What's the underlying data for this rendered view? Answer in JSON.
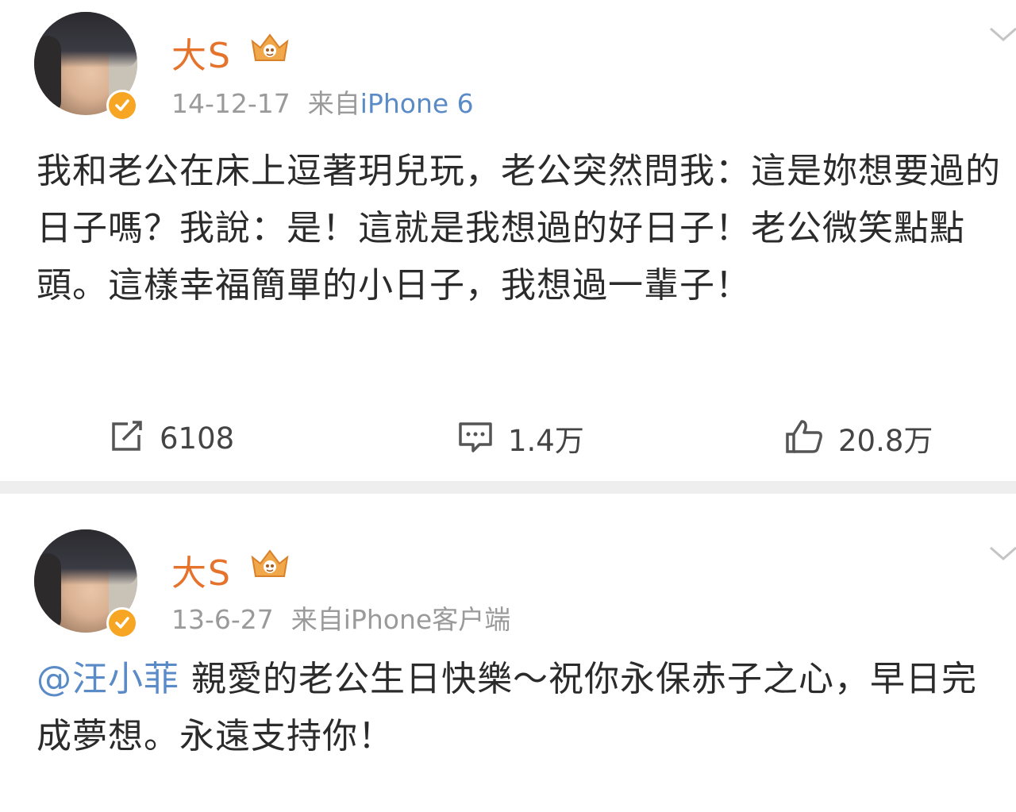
{
  "posts": [
    {
      "username": "大S",
      "date": "14-12-17",
      "source_prefix": "来自",
      "device": "iPhone 6",
      "content": "我和老公在床上逗著玥兒玩，老公突然問我：這是妳想要過的日子嗎？我說：是！這就是我想過的好日子！老公微笑點點頭。這樣幸福簡單的小日子，我想過一輩子！",
      "reposts": "6108",
      "comments": "1.4万",
      "likes": "20.8万"
    },
    {
      "username": "大S",
      "date": "13-6-27",
      "source_prefix": "来自",
      "device": "iPhone客户端",
      "mention": "@汪小菲",
      "content": " 親愛的老公生日快樂～祝你永保赤子之心，早日完成夢想。永遠支持你！"
    }
  ],
  "colors": {
    "username": "#e5732b",
    "link": "#5b8bc7",
    "meta": "#9a9a9a",
    "verified_badge": "#f6a623",
    "separator": "#eeeeee"
  },
  "icons": {
    "verified": "verified-check-icon",
    "vip": "crown-icon",
    "menu": "chevron-down-icon",
    "repost": "repost-icon",
    "comment": "comment-icon",
    "like": "thumbs-up-icon"
  }
}
